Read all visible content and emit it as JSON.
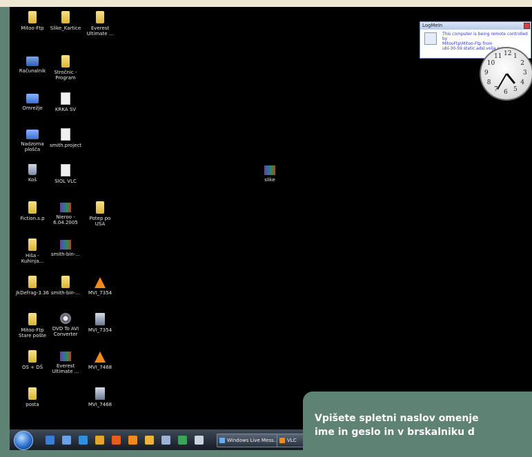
{
  "desktop_icons": [
    {
      "label": "Mitoo-Ftp",
      "type": "folder"
    },
    {
      "label": "Slike_Kartice",
      "type": "folder"
    },
    {
      "label": "Everest\nUltimate ...",
      "type": "folder"
    },
    {
      "label": "Računalnik",
      "type": "computer"
    },
    {
      "label": "Stročnic -\nProgram",
      "type": "folder"
    },
    {
      "label": "Omrežje",
      "type": "network"
    },
    {
      "label": "KRKA SV",
      "type": "doc"
    },
    {
      "label": "Nadzorna\nplošča",
      "type": "network"
    },
    {
      "label": "smith.project",
      "type": "doc"
    },
    {
      "label": "Koš",
      "type": "bin"
    },
    {
      "label": "SIOL VLC",
      "type": "doc"
    },
    {
      "label": "Fiction.s.p",
      "type": "folder"
    },
    {
      "label": "Nieroo -\n6.04.2005",
      "type": "winrar"
    },
    {
      "label": "Potep po\nUSA",
      "type": "folder"
    },
    {
      "label": "Hiša -\nKuhinja...",
      "type": "folder"
    },
    {
      "label": "smith-bin-...",
      "type": "winrar"
    },
    {
      "label": "JkDefrag-3.36",
      "type": "folder"
    },
    {
      "label": "smith-bin-...",
      "type": "folder"
    },
    {
      "label": "MVI_7354",
      "type": "cone"
    },
    {
      "label": "Mitoo-Ftp\nStare pošte",
      "type": "folder"
    },
    {
      "label": "DVD To AVI\nConverter",
      "type": "gear"
    },
    {
      "label": "MVI_7354",
      "type": "film"
    },
    {
      "label": "OS + DŠ",
      "type": "folder"
    },
    {
      "label": "Everest\nUltimate ...",
      "type": "winrar"
    },
    {
      "label": "MVI_7468",
      "type": "cone"
    },
    {
      "label": "posta",
      "type": "folder"
    },
    {
      "label": "MVI_7468",
      "type": "film"
    },
    {
      "label": "slike",
      "type": "winrar"
    }
  ],
  "notification": {
    "title": "LogMeIn",
    "line1": "This computer is being remote controlled by",
    "line2": "MitooFtp\\Mitoo-Ftp from",
    "line3": "ubl-30-59.static.adsl.volja.net"
  },
  "clock": {
    "numbers": [
      "12",
      "1",
      "2",
      "3",
      "4",
      "5",
      "6",
      "7",
      "8",
      "9",
      "10",
      "11"
    ],
    "hour": 4.7,
    "minute": 35
  },
  "taskbar": {
    "quicklaunch": [
      "show-desktop-icon",
      "switch-windows-icon",
      "internet-explorer-icon",
      "media-player-icon",
      "firefox-icon",
      "vlc-icon",
      "messenger-icon",
      "notepad-icon",
      "utorrent-icon",
      "search-icon"
    ],
    "buttons": [
      {
        "label": "Windows Live Mess..."
      },
      {
        "label": "VLC"
      }
    ]
  },
  "caption": {
    "line1": "Vpišete spletni naslov omenje",
    "line2": "ime in geslo in v brskalniku d"
  },
  "colors": {
    "frame": "#5e8273",
    "desktop": "#000000",
    "caption_text": "#ffffff"
  }
}
